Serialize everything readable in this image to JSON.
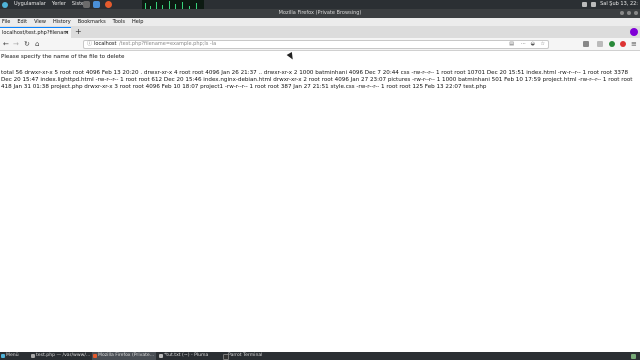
{
  "panel": {
    "menus": [
      "Uygulamalar",
      "Yerler",
      "Sistem"
    ],
    "clock": "Sal Şub 13, 22:"
  },
  "window": {
    "title": "Mozilla Firefox (Private Browsing)"
  },
  "menubar": [
    "File",
    "Edit",
    "View",
    "History",
    "Bookmarks",
    "Tools",
    "Help"
  ],
  "tab": {
    "label": "localhost/test.php?filenam",
    "close": "×",
    "new_tab": "+"
  },
  "url": {
    "host": "localhost",
    "path": "/test.php?filename=example.php;ls -la"
  },
  "page": {
    "prompt": "Please specify the name of the file to delete",
    "listing": "total 56 drwxr-xr-x 5 root root 4096 Feb 13 20:20 . drwxr-xr-x 4 root root 4096 Jan 26 21:37 .. drwxr-xr-x 2 1000 batminhani 4096 Dec 7 20:44 css -rw-r--r-- 1 root root 10701 Dec 20 15:51 index.html -rw-r--r-- 1 root root 3378 Dec 20 15:47 index.lighttpd.html -rw-r--r-- 1 root root 612 Dec 20 15:46 index.nginx-debian.html drwxr-xr-x 2 root root 4096 Jan 27 23:07 pictures -rw-r--r-- 1 1000 batminhani 501 Feb 10 17:59 project.html -rw-r--r-- 1 root root 418 Jan 31 01:38 project.php drwxr-xr-x 3 root root 4096 Feb 10 18:07 project1 -rw-r--r-- 1 root root 387 Jan 27 21:51 style.css -rw-r--r-- 1 root root 125 Feb 13 22:07 test.php"
  },
  "taskbar": {
    "items": [
      {
        "label": "Menü"
      },
      {
        "label": "test.php — /var/www/..."
      },
      {
        "label": "Mozilla Firefox (Private..."
      },
      {
        "label": "*tut.txt (~) - Pluma"
      },
      {
        "label": "Parrot Terminal"
      }
    ]
  },
  "colors": {
    "panel": "#2b2f33",
    "accent": "#0a84ff",
    "private": "#8000d7"
  }
}
